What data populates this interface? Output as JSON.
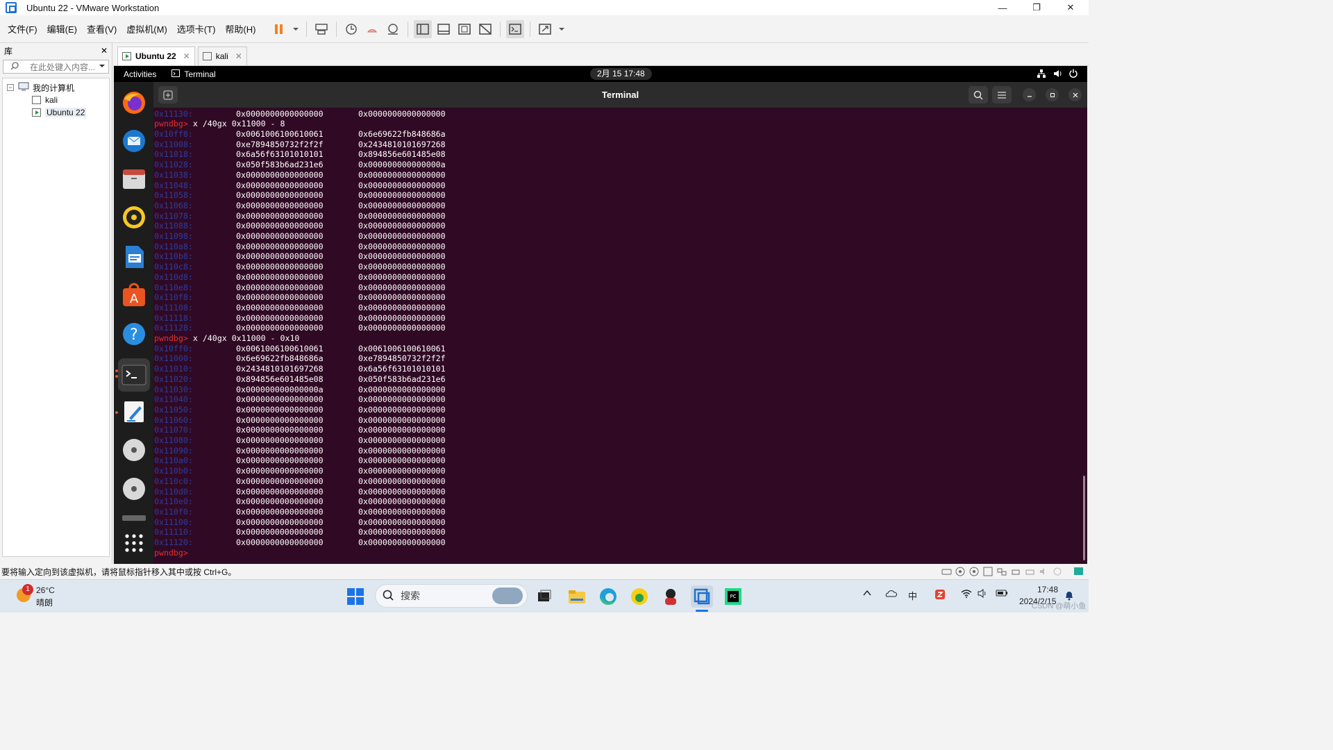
{
  "window": {
    "title": "Ubuntu 22 - VMware Workstation",
    "minimize": "—",
    "maximize": "❐",
    "close": "✕"
  },
  "menu": [
    "文件(F)",
    "编辑(E)",
    "查看(V)",
    "虚拟机(M)",
    "选项卡(T)",
    "帮助(H)"
  ],
  "library": {
    "title": "库",
    "close": "✕",
    "search_placeholder": "在此处键入内容...",
    "root": "我的计算机",
    "vms": [
      "kali",
      "Ubuntu 22"
    ]
  },
  "tabs": [
    {
      "label": "Ubuntu 22",
      "active": true,
      "close": "✕"
    },
    {
      "label": "kali",
      "active": false,
      "close": "✕"
    }
  ],
  "gnome": {
    "activities": "Activities",
    "app": "Terminal",
    "clock": "2月 15 17:48"
  },
  "terminal": {
    "title": "Terminal",
    "prompt": "pwndbg>",
    "lines": [
      {
        "t": "m",
        "a": "0x11130:",
        "v1": "0x0000000000000000",
        "v2": "0x0000000000000000"
      },
      {
        "t": "c",
        "cmd": " x /40gx 0x11000 - 8"
      },
      {
        "t": "m",
        "a": "0x10ff8:",
        "v1": "0x0061006100610061",
        "v2": "0x6e69622fb848686a"
      },
      {
        "t": "m",
        "a": "0x11008:",
        "v1": "0xe7894850732f2f2f",
        "v2": "0x2434810101697268"
      },
      {
        "t": "m",
        "a": "0x11018:",
        "v1": "0x6a56f63101010101",
        "v2": "0x894856e601485e08"
      },
      {
        "t": "m",
        "a": "0x11028:",
        "v1": "0x050f583b6ad231e6",
        "v2": "0x000000000000000a"
      },
      {
        "t": "m",
        "a": "0x11038:",
        "v1": "0x0000000000000000",
        "v2": "0x0000000000000000"
      },
      {
        "t": "m",
        "a": "0x11048:",
        "v1": "0x0000000000000000",
        "v2": "0x0000000000000000"
      },
      {
        "t": "m",
        "a": "0x11058:",
        "v1": "0x0000000000000000",
        "v2": "0x0000000000000000"
      },
      {
        "t": "m",
        "a": "0x11068:",
        "v1": "0x0000000000000000",
        "v2": "0x0000000000000000"
      },
      {
        "t": "m",
        "a": "0x11078:",
        "v1": "0x0000000000000000",
        "v2": "0x0000000000000000"
      },
      {
        "t": "m",
        "a": "0x11088:",
        "v1": "0x0000000000000000",
        "v2": "0x0000000000000000"
      },
      {
        "t": "m",
        "a": "0x11098:",
        "v1": "0x0000000000000000",
        "v2": "0x0000000000000000"
      },
      {
        "t": "m",
        "a": "0x110a8:",
        "v1": "0x0000000000000000",
        "v2": "0x0000000000000000"
      },
      {
        "t": "m",
        "a": "0x110b8:",
        "v1": "0x0000000000000000",
        "v2": "0x0000000000000000"
      },
      {
        "t": "m",
        "a": "0x110c8:",
        "v1": "0x0000000000000000",
        "v2": "0x0000000000000000"
      },
      {
        "t": "m",
        "a": "0x110d8:",
        "v1": "0x0000000000000000",
        "v2": "0x0000000000000000"
      },
      {
        "t": "m",
        "a": "0x110e8:",
        "v1": "0x0000000000000000",
        "v2": "0x0000000000000000"
      },
      {
        "t": "m",
        "a": "0x110f8:",
        "v1": "0x0000000000000000",
        "v2": "0x0000000000000000"
      },
      {
        "t": "m",
        "a": "0x11108:",
        "v1": "0x0000000000000000",
        "v2": "0x0000000000000000"
      },
      {
        "t": "m",
        "a": "0x11118:",
        "v1": "0x0000000000000000",
        "v2": "0x0000000000000000"
      },
      {
        "t": "m",
        "a": "0x11128:",
        "v1": "0x0000000000000000",
        "v2": "0x0000000000000000"
      },
      {
        "t": "c",
        "cmd": " x /40gx 0x11000 - 0x10"
      },
      {
        "t": "m",
        "a": "0x10ff0:",
        "v1": "0x0061006100610061",
        "v2": "0x0061006100610061"
      },
      {
        "t": "m",
        "a": "0x11000:",
        "v1": "0x6e69622fb848686a",
        "v2": "0xe7894850732f2f2f"
      },
      {
        "t": "m",
        "a": "0x11010:",
        "v1": "0x2434810101697268",
        "v2": "0x6a56f63101010101"
      },
      {
        "t": "m",
        "a": "0x11020:",
        "v1": "0x894856e601485e08",
        "v2": "0x050f583b6ad231e6"
      },
      {
        "t": "m",
        "a": "0x11030:",
        "v1": "0x000000000000000a",
        "v2": "0x0000000000000000"
      },
      {
        "t": "m",
        "a": "0x11040:",
        "v1": "0x0000000000000000",
        "v2": "0x0000000000000000"
      },
      {
        "t": "m",
        "a": "0x11050:",
        "v1": "0x0000000000000000",
        "v2": "0x0000000000000000"
      },
      {
        "t": "m",
        "a": "0x11060:",
        "v1": "0x0000000000000000",
        "v2": "0x0000000000000000"
      },
      {
        "t": "m",
        "a": "0x11070:",
        "v1": "0x0000000000000000",
        "v2": "0x0000000000000000"
      },
      {
        "t": "m",
        "a": "0x11080:",
        "v1": "0x0000000000000000",
        "v2": "0x0000000000000000"
      },
      {
        "t": "m",
        "a": "0x11090:",
        "v1": "0x0000000000000000",
        "v2": "0x0000000000000000"
      },
      {
        "t": "m",
        "a": "0x110a0:",
        "v1": "0x0000000000000000",
        "v2": "0x0000000000000000"
      },
      {
        "t": "m",
        "a": "0x110b0:",
        "v1": "0x0000000000000000",
        "v2": "0x0000000000000000"
      },
      {
        "t": "m",
        "a": "0x110c0:",
        "v1": "0x0000000000000000",
        "v2": "0x0000000000000000"
      },
      {
        "t": "m",
        "a": "0x110d0:",
        "v1": "0x0000000000000000",
        "v2": "0x0000000000000000"
      },
      {
        "t": "m",
        "a": "0x110e0:",
        "v1": "0x0000000000000000",
        "v2": "0x0000000000000000"
      },
      {
        "t": "m",
        "a": "0x110f0:",
        "v1": "0x0000000000000000",
        "v2": "0x0000000000000000"
      },
      {
        "t": "m",
        "a": "0x11100:",
        "v1": "0x0000000000000000",
        "v2": "0x0000000000000000"
      },
      {
        "t": "m",
        "a": "0x11110:",
        "v1": "0x0000000000000000",
        "v2": "0x0000000000000000"
      },
      {
        "t": "m",
        "a": "0x11120:",
        "v1": "0x0000000000000000",
        "v2": "0x0000000000000000"
      },
      {
        "t": "c",
        "cmd": ""
      }
    ]
  },
  "status": {
    "hint": "要将输入定向到该虚拟机，请将鼠标指针移入其中或按 Ctrl+G。"
  },
  "taskbar": {
    "weather_temp": "26°C",
    "weather_desc": "晴朗",
    "weather_badge": "1",
    "search_label": "搜索",
    "time": "17:48",
    "date": "2024/2/15",
    "watermark": "CSDN @萌小鱼",
    "input_method": "中"
  },
  "colors": {
    "terminal_bg": "#300a24",
    "prompt": "#e02e2e",
    "address": "#2c3e9e",
    "pause_accent": "#f5821f"
  }
}
